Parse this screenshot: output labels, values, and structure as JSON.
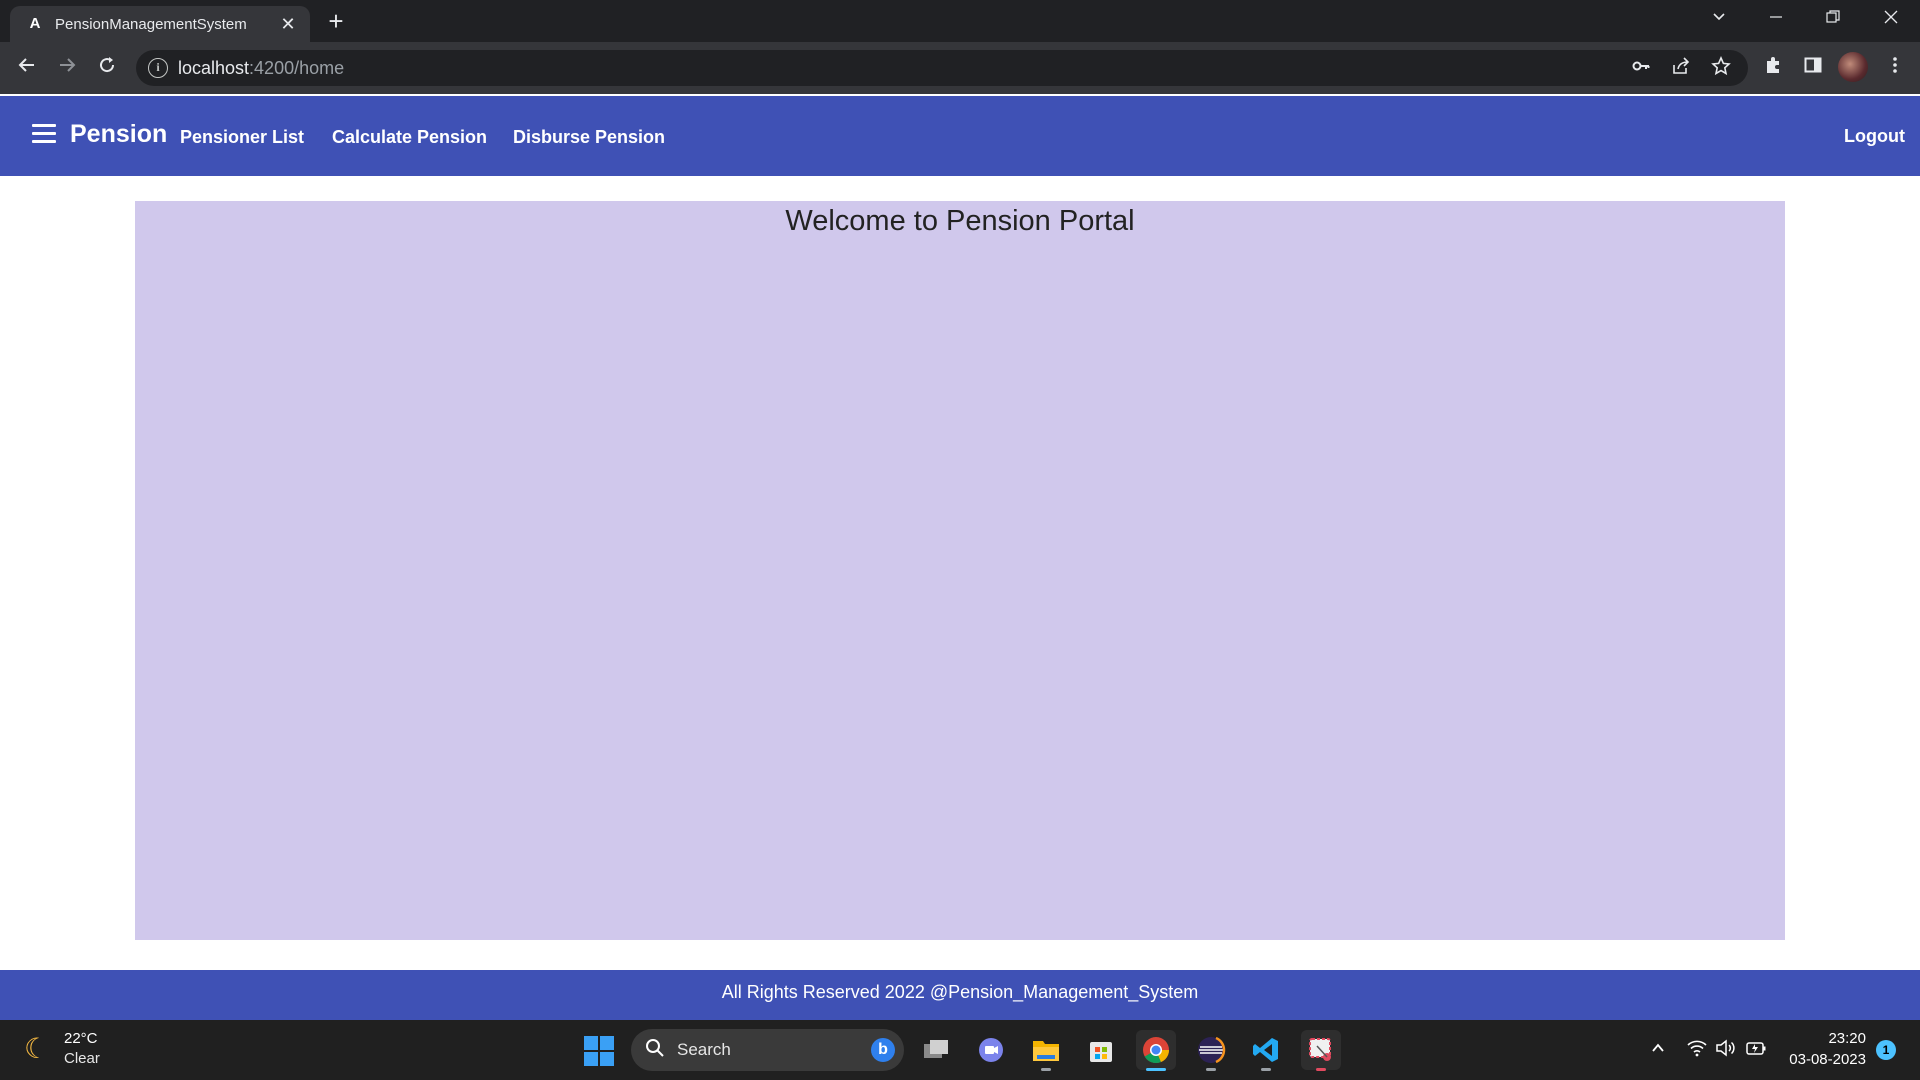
{
  "browser": {
    "tab_title": "PensionManagementSystem",
    "tab_favicon": "A",
    "url_host": "localhost",
    "url_rest": ":4200/home",
    "new_tab_symbol": "+",
    "close_symbol": "✕"
  },
  "app": {
    "brand": "Pension",
    "nav": {
      "pensioner_list": "Pensioner List",
      "calculate_pension": "Calculate Pension",
      "disburse_pension": "Disburse Pension"
    },
    "logout": "Logout",
    "welcome": "Welcome to Pension Portal",
    "footer": "All Rights Reserved 2022 @Pension_Management_System",
    "colors": {
      "primary": "#3f51b5",
      "panel": "#d0c8ec"
    }
  },
  "taskbar": {
    "weather_temp": "22°C",
    "weather_desc": "Clear",
    "search_label": "Search",
    "time": "23:20",
    "date": "03-08-2023",
    "notification_count": "1"
  }
}
